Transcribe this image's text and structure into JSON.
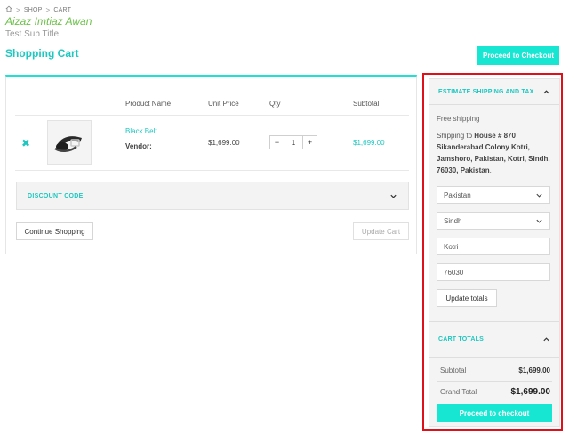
{
  "breadcrumb": {
    "items": [
      "SHOP",
      "CART"
    ],
    "separator": ">"
  },
  "site_title": "Aizaz Imtiaz Awan",
  "sub_title": "Test Sub Title",
  "page_title": "Shopping Cart",
  "top_checkout_label": "Proceed to Checkout",
  "cart": {
    "headers": {
      "product": "Product Name",
      "unit_price": "Unit Price",
      "qty": "Qty",
      "subtotal": "Subtotal"
    },
    "items": [
      {
        "name": "Black Belt",
        "vendor_label": "Vendor:",
        "unit_price": "$1,699.00",
        "qty": "1",
        "subtotal": "$1,699.00",
        "minus": "−",
        "plus": "+",
        "remove": "✖"
      }
    ],
    "discount_label": "DISCOUNT CODE",
    "continue_label": "Continue Shopping",
    "update_cart_label": "Update Cart"
  },
  "shipping": {
    "title": "ESTIMATE SHIPPING AND TAX",
    "method": "Free shipping",
    "to_prefix": "Shipping to ",
    "address": "House # 870 Sikanderabad Colony Kotri, Jamshoro, Pakistan, Kotri, Sindh, 76030, Pakistan",
    "address_end": ".",
    "country": "Pakistan",
    "state": "Sindh",
    "city": "Kotri",
    "postcode": "76030",
    "update_totals_label": "Update totals"
  },
  "totals": {
    "title": "CART TOTALS",
    "subtotal_label": "Subtotal",
    "subtotal_value": "$1,699.00",
    "grand_label": "Grand Total",
    "grand_value": "$1,699.00",
    "checkout_label": "Proceed to checkout"
  },
  "colors": {
    "accent": "#17e6d3",
    "accent_text": "#1ec7c0",
    "site_title": "#6cc24a",
    "highlight": "#e0101a"
  },
  "icons": {
    "home": "home-icon",
    "remove": "remove-icon",
    "chevron_down": "chevron-down-icon",
    "chevron_up": "chevron-up-icon"
  }
}
